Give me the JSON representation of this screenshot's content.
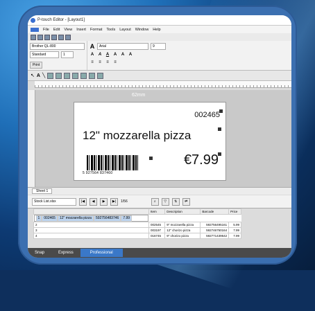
{
  "window": {
    "title": "P-touch Editor - [Layout1]"
  },
  "menu": [
    "File",
    "Edit",
    "View",
    "Insert",
    "Format",
    "Tools",
    "Layout",
    "Window",
    "Help"
  ],
  "printer": {
    "name": "Brother QL-800",
    "paper": "Standard",
    "copies": "1",
    "print_label": "Print"
  },
  "font": {
    "family": "Arial",
    "size": "9"
  },
  "ruler": {
    "width_label": "62mm"
  },
  "label": {
    "serial": "002465",
    "item": "12\" mozzarella pizza",
    "price": "€7.99",
    "barcode_number": "5 927564 837460"
  },
  "sheet": {
    "tab": "Sheet 1"
  },
  "database": {
    "file": "Stock List.xlsx",
    "nav_label": "1/56"
  },
  "table": {
    "headers": [
      "",
      "Item",
      "Description",
      "Barcode",
      "Price"
    ],
    "rows": [
      [
        "1",
        "002465",
        "12\" mozzarella pizza",
        "592756483746",
        "7.99"
      ],
      [
        "2",
        "002545",
        "9\" mozzarella pizza",
        "592756495161",
        "5.99"
      ],
      [
        "3",
        "003197",
        "12\" chorizo pizza",
        "592746750164",
        "7.99"
      ],
      [
        "4",
        "016745",
        "9\" chorizo pizza",
        "592771439542",
        "7.99"
      ]
    ]
  },
  "modes": {
    "snap": "Snap",
    "express": "Express",
    "professional": "Professional"
  }
}
